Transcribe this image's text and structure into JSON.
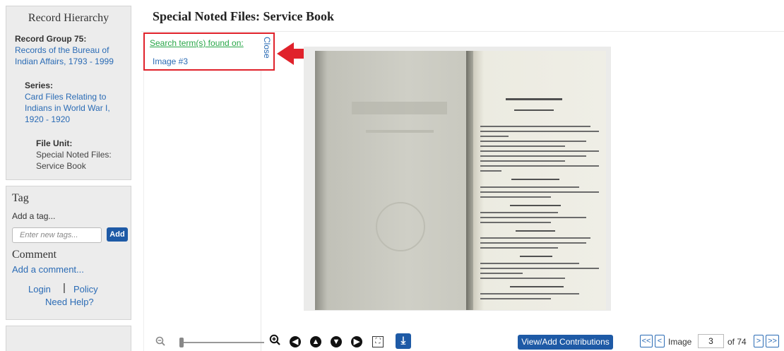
{
  "sidebar": {
    "hierarchy_title": "Record Hierarchy",
    "record_group_label": "Record Group 75:",
    "record_group_link_lines": [
      "Records of the Bureau of",
      "Indian Affairs, 1793 - 1999"
    ],
    "series_label": "Series:",
    "series_link_lines": [
      "Card Files Relating to",
      "Indians in World War I,",
      "1920 - 1920"
    ],
    "file_unit_label": "File Unit:",
    "file_unit_text_lines": [
      "Special Noted Files:",
      "Service Book"
    ],
    "tag_title": "Tag",
    "add_tag_text": "Add a tag...",
    "tag_input_placeholder": "Enter new tags...",
    "add_button": "Add",
    "comment_title": "Comment",
    "add_comment_link": "Add a comment...",
    "login_link": "Login",
    "separator": "|",
    "policy_link": "Policy",
    "need_help_link": "Need Help?"
  },
  "main": {
    "title": "Special Noted Files: Service Book"
  },
  "search_panel": {
    "found_label": "Search term(s) found on:",
    "image_link": "Image #3",
    "close_label": "Close"
  },
  "toolbar": {
    "zoom_out_icon": "zoom-out-icon",
    "zoom_in_icon": "zoom-in-icon",
    "rotate_left": "◀",
    "rotate_up": "▲",
    "rotate_down": "▼",
    "rotate_right": "▶",
    "fullscreen": "⛶",
    "download": "⤓",
    "view_contributions_button": "View/Add Contributions"
  },
  "pagination": {
    "first": "<<",
    "prev": "<",
    "image_label": "Image",
    "current_page": "3",
    "of_label": "of 74",
    "next": ">",
    "last": ">>"
  },
  "colors": {
    "accent": "#1e5aa6",
    "link": "#2a6bb5",
    "highlight": "#e0222b",
    "search_found": "#27a647"
  }
}
